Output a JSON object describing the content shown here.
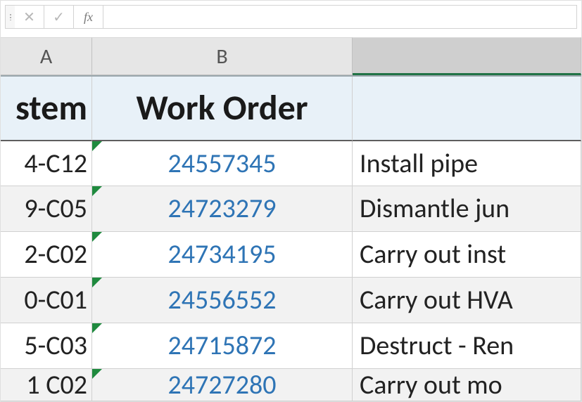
{
  "formula_bar": {
    "cancel_tooltip": "Cancel",
    "enter_tooltip": "Enter",
    "fx_label": "fx",
    "value": ""
  },
  "columns": {
    "A": "A",
    "B": "B",
    "C": ""
  },
  "header_row": {
    "A": "stem",
    "B": "Work Order",
    "C": ""
  },
  "rows": [
    {
      "system": "4-C12",
      "work_order": "24557345",
      "desc": "Install pipe",
      "shaded": false
    },
    {
      "system": "9-C05",
      "work_order": "24723279",
      "desc": "Dismantle jun",
      "shaded": true
    },
    {
      "system": "2-C02",
      "work_order": "24734195",
      "desc": "Carry out inst",
      "shaded": false
    },
    {
      "system": "0-C01",
      "work_order": "24556552",
      "desc": "Carry out HVA",
      "shaded": true
    },
    {
      "system": "5-C03",
      "work_order": "24715872",
      "desc": "Destruct - Ren",
      "shaded": false
    },
    {
      "system": "1  C02",
      "work_order": "24727280",
      "desc": "Carry out mo",
      "shaded": true
    }
  ],
  "glyphs": {
    "cancel": "✕",
    "enter": "✓"
  }
}
